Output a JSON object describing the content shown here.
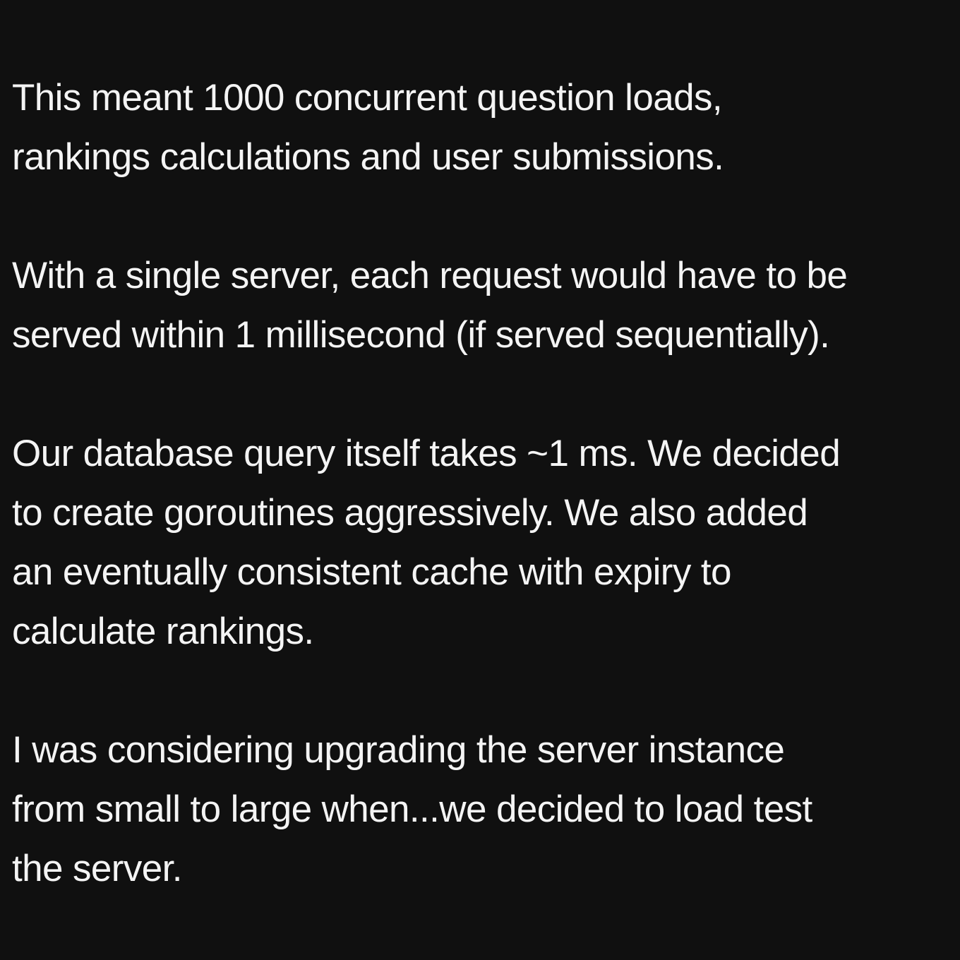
{
  "colors": {
    "background": "#101010",
    "text": "#f4f4f4"
  },
  "paragraphs": [
    {
      "lines": [
        "This meant 1000 concurrent question loads,",
        "rankings calculations and user submissions."
      ]
    },
    {
      "lines": [
        "With a single server, each request would have to be",
        "served within 1 millisecond (if served sequentially)."
      ]
    },
    {
      "lines": [
        "Our database query itself takes ~1 ms. We decided",
        "to create goroutines aggressively. We also added",
        "an eventually consistent cache with expiry to",
        "calculate rankings."
      ]
    },
    {
      "lines": [
        "I was considering upgrading the server instance",
        "from small to large when...we decided to load test",
        "the server."
      ]
    }
  ]
}
